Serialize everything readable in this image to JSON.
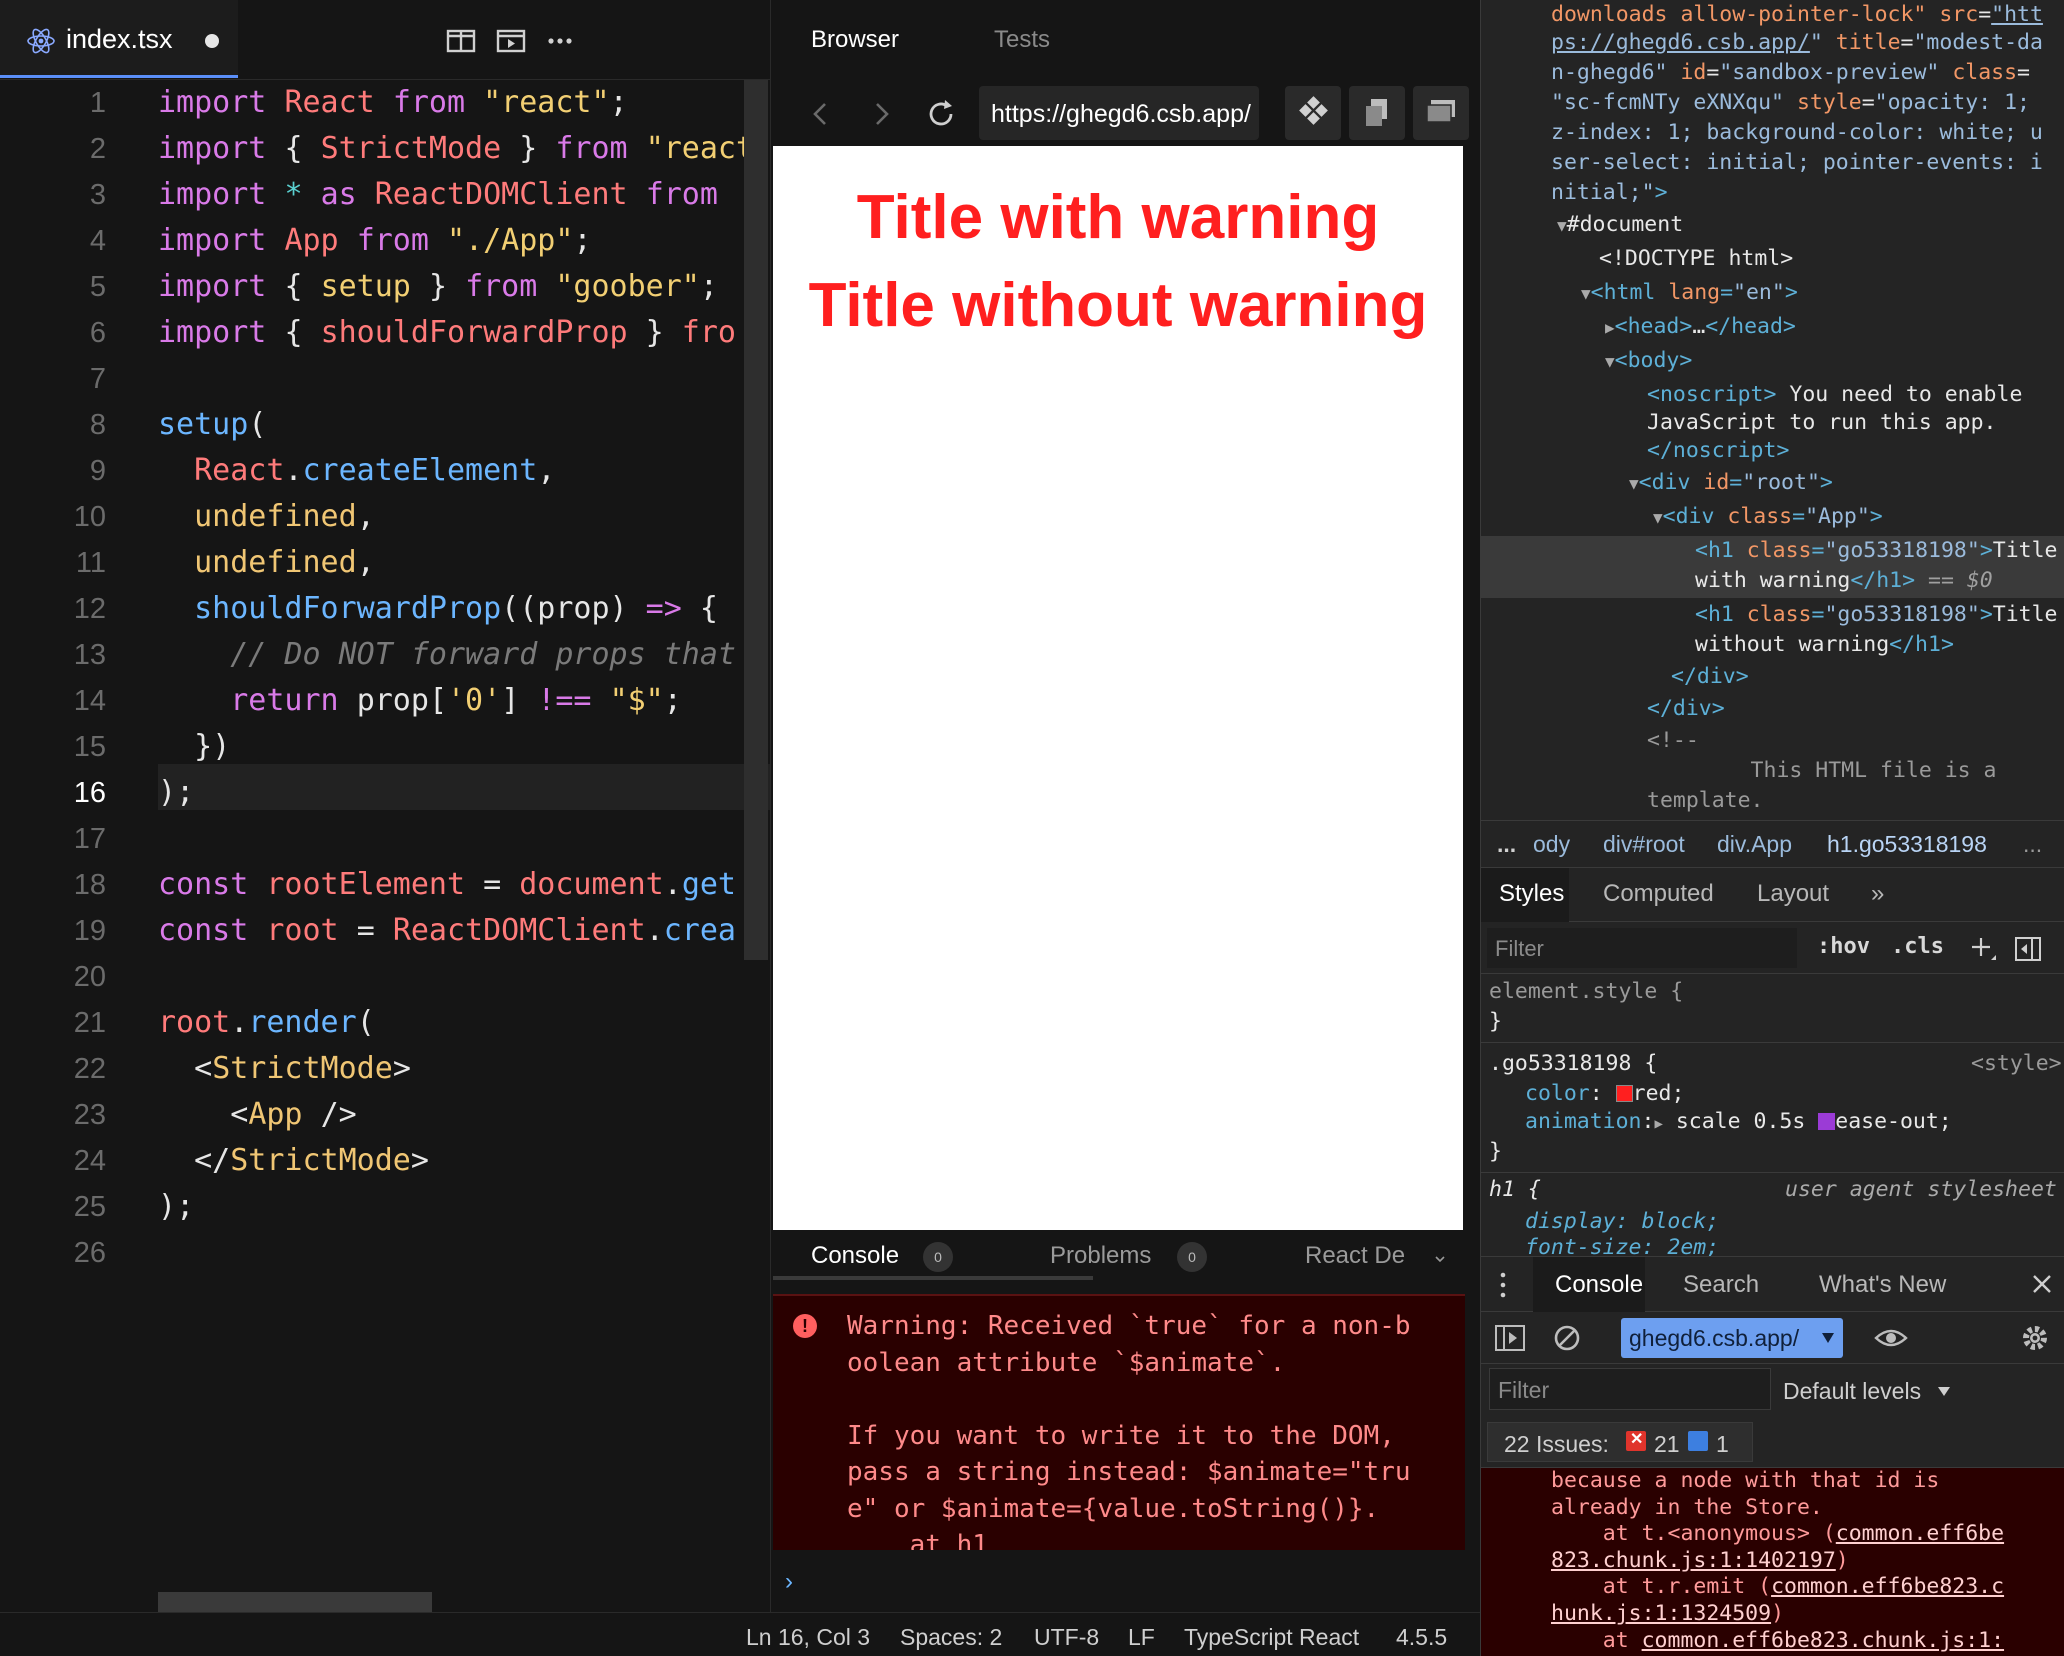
{
  "editor": {
    "file_name": "index.tsx",
    "line_numbers": [
      "1",
      "2",
      "3",
      "4",
      "5",
      "6",
      "7",
      "8",
      "9",
      "10",
      "11",
      "12",
      "13",
      "14",
      "15",
      "16",
      "17",
      "18",
      "19",
      "20",
      "21",
      "22",
      "23",
      "24",
      "25",
      "26"
    ],
    "active_line": "16",
    "code": [
      "import React from \"react\";",
      "import { StrictMode } from \"react",
      "import * as ReactDOMClient from",
      "import App from \"./App\";",
      "import { setup } from \"goober\";",
      "import { shouldForwardProp } fro",
      "",
      "setup(",
      "  React.createElement,",
      "  undefined,",
      "  undefined,",
      "  shouldForwardProp((prop) => {",
      "    // Do NOT forward props that",
      "    return prop['0'] !== \"$\";",
      "  })",
      ");",
      "",
      "const rootElement = document.get",
      "const root = ReactDOMClient.crea",
      "",
      "root.render(",
      "  <StrictMode>",
      "    <App />",
      "  </StrictMode>",
      ");",
      ""
    ]
  },
  "browser": {
    "tabs": [
      "Browser",
      "Tests"
    ],
    "url": "https://ghegd6.csb.app/",
    "preview": {
      "h1_first": "Title with warning",
      "h1_second": "Title without warning"
    },
    "console_tabs": {
      "console": "Console",
      "console_count": "0",
      "problems": "Problems",
      "problems_count": "0",
      "react": "React De"
    },
    "console_message": "Warning: Received `true` for a non-b\noolean attribute `$animate`.\n\nIf you want to write it to the DOM,\npass a string instead: $animate=\"tru\ne\" or $animate={value.toString()}.\n    at h1",
    "prompt": "›"
  },
  "statusbar": {
    "position": "Ln 16, Col 3",
    "spaces": "Spaces: 2",
    "encoding": "UTF-8",
    "eol": "LF",
    "language": "TypeScript React",
    "version": "4.5.5"
  },
  "devtools": {
    "breadcrumbs": [
      "...",
      "ody",
      "div#root",
      "div.App",
      "h1.go53318198",
      "..."
    ],
    "styles_tabs": [
      "Styles",
      "Computed",
      "Layout",
      "»"
    ],
    "styles_filter_placeholder": "Filter",
    "hov": ":hov",
    "cls": ".cls",
    "element_style": "element.style {",
    "rule_selector": ".go53318198 {",
    "rule_source": "<style>",
    "color_prop": "color",
    "color_val": "red;",
    "anim_prop": "animation",
    "anim_val1": "scale 0.5s",
    "anim_val2": "ease-out;",
    "ua_selector": "h1 {",
    "ua_source": "user agent stylesheet",
    "ua_display": "display: block;",
    "ua_fontsize": "font-size: 2em;",
    "drawer_tabs": [
      "Console",
      "Search",
      "What's New"
    ],
    "context": "ghegd6.csb.app/",
    "console_filter_placeholder": "Filter",
    "default_levels": "Default levels",
    "issues_label": "22 Issues:",
    "issues_errors": "21",
    "issues_info": "1",
    "colors": {
      "accent": "#6d9ff0",
      "error_bg": "#2a0000",
      "title_red": "#ff1f1f"
    }
  }
}
